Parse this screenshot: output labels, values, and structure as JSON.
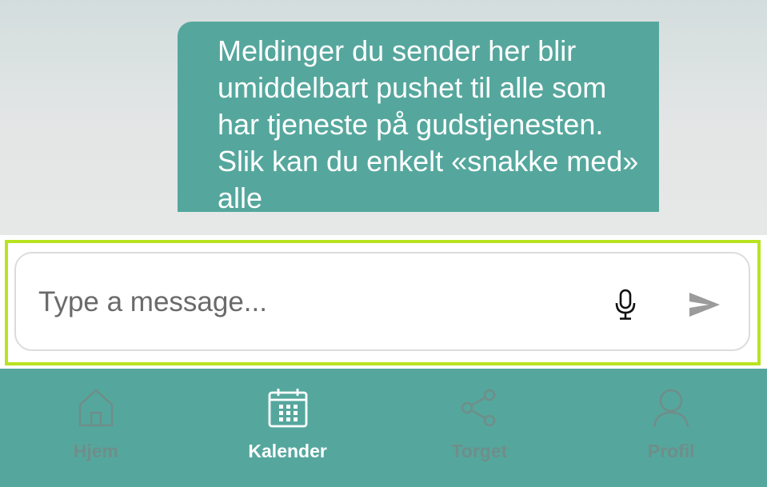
{
  "chat": {
    "message_text": "Meldinger du sender her blir umiddelbart pushet til alle som har tjeneste på gudstjenesten. Slik kan du enkelt «snakke med» alle"
  },
  "composer": {
    "placeholder": "Type a message...",
    "value": ""
  },
  "tabs": [
    {
      "label": "Hjem",
      "icon": "home-icon",
      "active": false
    },
    {
      "label": "Kalender",
      "icon": "calendar-icon",
      "active": true
    },
    {
      "label": "Torget",
      "icon": "share-icon",
      "active": false
    },
    {
      "label": "Profil",
      "icon": "user-icon",
      "active": false
    }
  ],
  "colors": {
    "accent": "#55a79d",
    "highlight_border": "#b8e31f",
    "inactive_tab": "#6f8e8a",
    "active_tab": "#ffffff"
  }
}
